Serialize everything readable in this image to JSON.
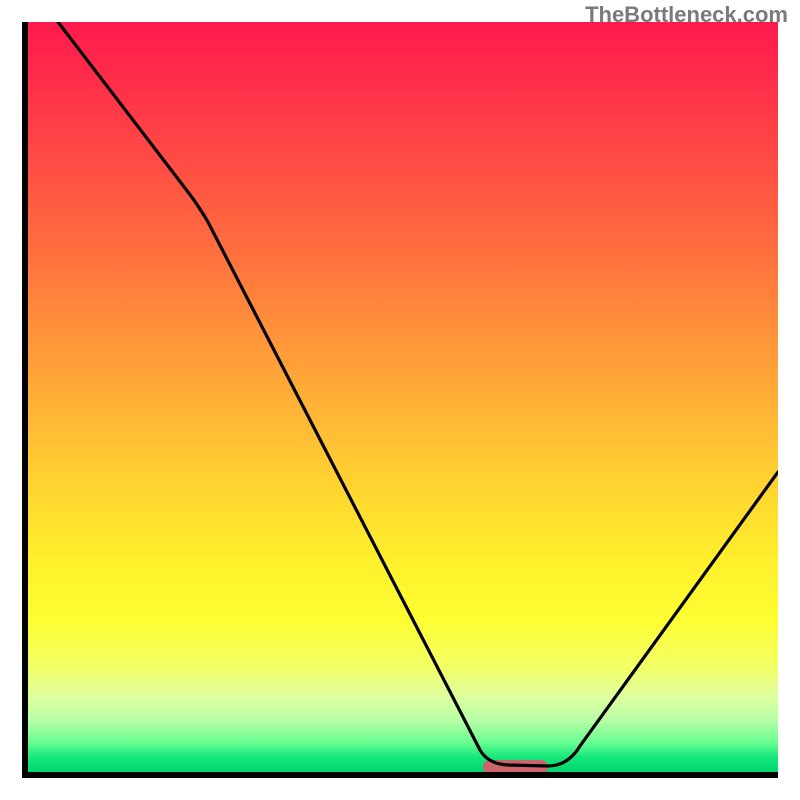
{
  "watermark": "TheBottleneck.com",
  "chart_data": {
    "type": "line",
    "title": "",
    "xlabel": "",
    "ylabel": "",
    "xlim": [
      0,
      100
    ],
    "ylim": [
      0,
      100
    ],
    "grid": false,
    "series": [
      {
        "name": "bottleneck-curve",
        "x": [
          4,
          22,
          60,
          66,
          72,
          100
        ],
        "values": [
          100,
          77,
          3,
          0.8,
          1.2,
          40
        ]
      }
    ],
    "highlight_band": {
      "x_start": 61,
      "x_end": 69,
      "color": "#cc646a"
    },
    "background_gradient": {
      "top": "#ff1a4d",
      "bottom": "#00d66e"
    }
  }
}
